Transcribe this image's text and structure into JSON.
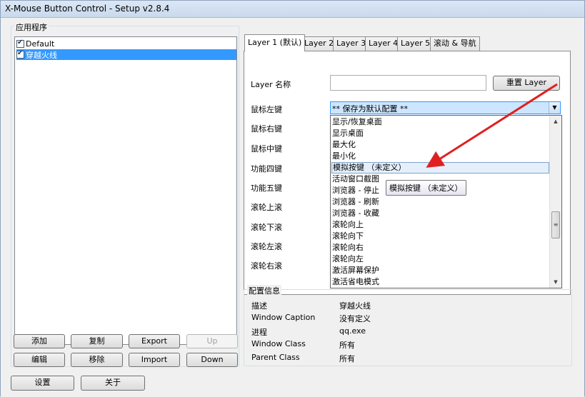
{
  "window": {
    "title": "X-Mouse Button Control - Setup v2.8.4"
  },
  "apps": {
    "group_label": "应用程序",
    "items": [
      {
        "label": "Default",
        "checked": true,
        "selected": false
      },
      {
        "label": "穿越火线",
        "checked": true,
        "selected": true
      }
    ],
    "buttons": {
      "add": "添加",
      "copy": "复制",
      "export": "Export",
      "up": "Up",
      "edit": "编辑",
      "remove": "移除",
      "import": "Import",
      "down": "Down"
    }
  },
  "bottom_buttons": {
    "settings": "设置",
    "about": "关于"
  },
  "tabs": [
    {
      "label": "Layer 1 (默认)",
      "active": true
    },
    {
      "label": "Layer 2",
      "active": false
    },
    {
      "label": "Layer 3",
      "active": false
    },
    {
      "label": "Layer 4",
      "active": false
    },
    {
      "label": "Layer 5",
      "active": false
    },
    {
      "label": "滚动 & 导航",
      "active": false
    }
  ],
  "layer": {
    "name_label": "Layer 名称",
    "name_value": "",
    "reset_button": "重置 Layer",
    "rows": [
      "鼠标左键",
      "鼠标右键",
      "鼠标中键",
      "功能四键",
      "功能五键",
      "滚轮上滚",
      "滚轮下滚",
      "滚轮左滚",
      "滚轮右滚"
    ],
    "left_combo_value": "** 保存为默认配置 **"
  },
  "dropdown": {
    "options": [
      "显示/恢复桌面",
      "显示桌面",
      "最大化",
      "最小化",
      "模拟按键 （未定义）",
      "活动窗口截图",
      "浏览器 - 停止",
      "浏览器 - 刷新",
      "浏览器 - 收藏",
      "滚轮向上",
      "滚轮向下",
      "滚轮向右",
      "滚轮向左",
      "激活屏幕保护",
      "激活省电模式"
    ],
    "highlighted_index": 4,
    "tooltip": "模拟按键 （未定义）"
  },
  "config_info": {
    "group_label": "配置信息",
    "rows": [
      {
        "key": "描述",
        "value": "穿越火线"
      },
      {
        "key": "Window Caption",
        "value": "没有定义"
      },
      {
        "key": "进程",
        "value": "qq.exe"
      },
      {
        "key": "Window Class",
        "value": "所有"
      },
      {
        "key": "Parent Class",
        "value": "所有"
      }
    ]
  },
  "colors": {
    "selection": "#3399ff",
    "arrow": "#e02020",
    "tab_border": "#8c8c8c"
  },
  "icons": {
    "dropdown_arrow": "chevron-down-icon",
    "scroll_up": "scroll-up-icon",
    "scroll_down": "scroll-down-icon",
    "checkbox": "checkbox-icon",
    "annotation": "red-arrow-icon"
  }
}
